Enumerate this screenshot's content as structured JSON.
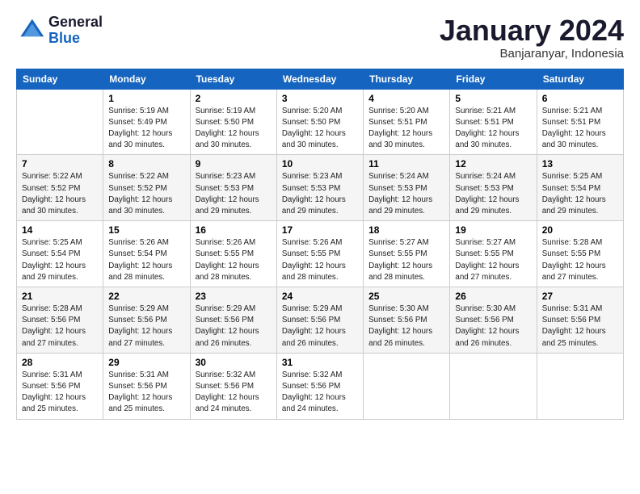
{
  "header": {
    "logo_general": "General",
    "logo_blue": "Blue",
    "month_title": "January 2024",
    "subtitle": "Banjaranyar, Indonesia"
  },
  "weekdays": [
    "Sunday",
    "Monday",
    "Tuesday",
    "Wednesday",
    "Thursday",
    "Friday",
    "Saturday"
  ],
  "weeks": [
    [
      {
        "day": "",
        "info": ""
      },
      {
        "day": "1",
        "info": "Sunrise: 5:19 AM\nSunset: 5:49 PM\nDaylight: 12 hours\nand 30 minutes."
      },
      {
        "day": "2",
        "info": "Sunrise: 5:19 AM\nSunset: 5:50 PM\nDaylight: 12 hours\nand 30 minutes."
      },
      {
        "day": "3",
        "info": "Sunrise: 5:20 AM\nSunset: 5:50 PM\nDaylight: 12 hours\nand 30 minutes."
      },
      {
        "day": "4",
        "info": "Sunrise: 5:20 AM\nSunset: 5:51 PM\nDaylight: 12 hours\nand 30 minutes."
      },
      {
        "day": "5",
        "info": "Sunrise: 5:21 AM\nSunset: 5:51 PM\nDaylight: 12 hours\nand 30 minutes."
      },
      {
        "day": "6",
        "info": "Sunrise: 5:21 AM\nSunset: 5:51 PM\nDaylight: 12 hours\nand 30 minutes."
      }
    ],
    [
      {
        "day": "7",
        "info": "Sunrise: 5:22 AM\nSunset: 5:52 PM\nDaylight: 12 hours\nand 30 minutes."
      },
      {
        "day": "8",
        "info": "Sunrise: 5:22 AM\nSunset: 5:52 PM\nDaylight: 12 hours\nand 30 minutes."
      },
      {
        "day": "9",
        "info": "Sunrise: 5:23 AM\nSunset: 5:53 PM\nDaylight: 12 hours\nand 29 minutes."
      },
      {
        "day": "10",
        "info": "Sunrise: 5:23 AM\nSunset: 5:53 PM\nDaylight: 12 hours\nand 29 minutes."
      },
      {
        "day": "11",
        "info": "Sunrise: 5:24 AM\nSunset: 5:53 PM\nDaylight: 12 hours\nand 29 minutes."
      },
      {
        "day": "12",
        "info": "Sunrise: 5:24 AM\nSunset: 5:53 PM\nDaylight: 12 hours\nand 29 minutes."
      },
      {
        "day": "13",
        "info": "Sunrise: 5:25 AM\nSunset: 5:54 PM\nDaylight: 12 hours\nand 29 minutes."
      }
    ],
    [
      {
        "day": "14",
        "info": "Sunrise: 5:25 AM\nSunset: 5:54 PM\nDaylight: 12 hours\nand 29 minutes."
      },
      {
        "day": "15",
        "info": "Sunrise: 5:26 AM\nSunset: 5:54 PM\nDaylight: 12 hours\nand 28 minutes."
      },
      {
        "day": "16",
        "info": "Sunrise: 5:26 AM\nSunset: 5:55 PM\nDaylight: 12 hours\nand 28 minutes."
      },
      {
        "day": "17",
        "info": "Sunrise: 5:26 AM\nSunset: 5:55 PM\nDaylight: 12 hours\nand 28 minutes."
      },
      {
        "day": "18",
        "info": "Sunrise: 5:27 AM\nSunset: 5:55 PM\nDaylight: 12 hours\nand 28 minutes."
      },
      {
        "day": "19",
        "info": "Sunrise: 5:27 AM\nSunset: 5:55 PM\nDaylight: 12 hours\nand 27 minutes."
      },
      {
        "day": "20",
        "info": "Sunrise: 5:28 AM\nSunset: 5:55 PM\nDaylight: 12 hours\nand 27 minutes."
      }
    ],
    [
      {
        "day": "21",
        "info": "Sunrise: 5:28 AM\nSunset: 5:56 PM\nDaylight: 12 hours\nand 27 minutes."
      },
      {
        "day": "22",
        "info": "Sunrise: 5:29 AM\nSunset: 5:56 PM\nDaylight: 12 hours\nand 27 minutes."
      },
      {
        "day": "23",
        "info": "Sunrise: 5:29 AM\nSunset: 5:56 PM\nDaylight: 12 hours\nand 26 minutes."
      },
      {
        "day": "24",
        "info": "Sunrise: 5:29 AM\nSunset: 5:56 PM\nDaylight: 12 hours\nand 26 minutes."
      },
      {
        "day": "25",
        "info": "Sunrise: 5:30 AM\nSunset: 5:56 PM\nDaylight: 12 hours\nand 26 minutes."
      },
      {
        "day": "26",
        "info": "Sunrise: 5:30 AM\nSunset: 5:56 PM\nDaylight: 12 hours\nand 26 minutes."
      },
      {
        "day": "27",
        "info": "Sunrise: 5:31 AM\nSunset: 5:56 PM\nDaylight: 12 hours\nand 25 minutes."
      }
    ],
    [
      {
        "day": "28",
        "info": "Sunrise: 5:31 AM\nSunset: 5:56 PM\nDaylight: 12 hours\nand 25 minutes."
      },
      {
        "day": "29",
        "info": "Sunrise: 5:31 AM\nSunset: 5:56 PM\nDaylight: 12 hours\nand 25 minutes."
      },
      {
        "day": "30",
        "info": "Sunrise: 5:32 AM\nSunset: 5:56 PM\nDaylight: 12 hours\nand 24 minutes."
      },
      {
        "day": "31",
        "info": "Sunrise: 5:32 AM\nSunset: 5:56 PM\nDaylight: 12 hours\nand 24 minutes."
      },
      {
        "day": "",
        "info": ""
      },
      {
        "day": "",
        "info": ""
      },
      {
        "day": "",
        "info": ""
      }
    ]
  ]
}
